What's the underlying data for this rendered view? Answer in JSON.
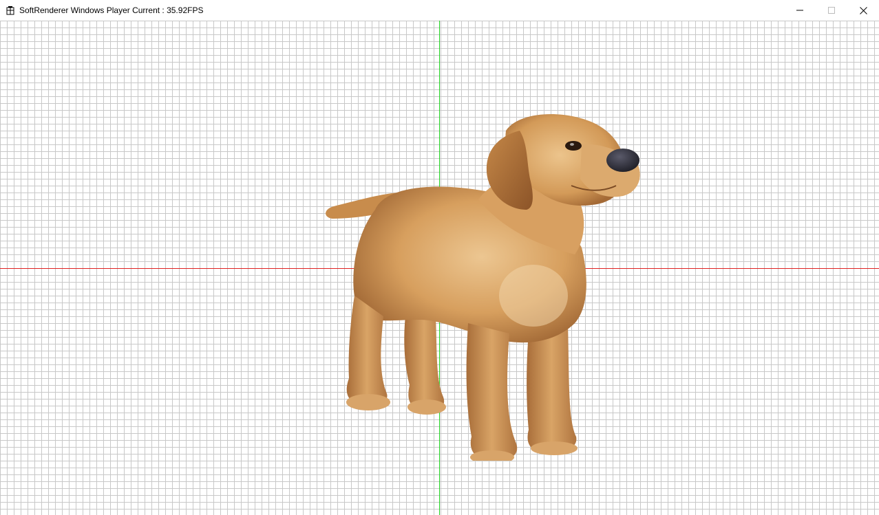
{
  "window": {
    "title": "SoftRenderer Windows Player Current : 35.92FPS",
    "app_icon": "app-icon",
    "caption_buttons": [
      {
        "name": "minimize",
        "icon": "minimize-icon"
      },
      {
        "name": "maximize",
        "icon": "maximize-icon"
      },
      {
        "name": "close",
        "icon": "close-icon"
      }
    ]
  },
  "viewport": {
    "background": "#ffffff",
    "grid_color": "#c8c8c8",
    "x_axis_color": "#e02020",
    "y_axis_color": "#20d020",
    "model": "dog-3d-model",
    "model_colors": {
      "fur_light": "#e0b47a",
      "fur_mid": "#c98d4a",
      "fur_dark": "#8a5527",
      "nose": "#2a2a34"
    }
  }
}
